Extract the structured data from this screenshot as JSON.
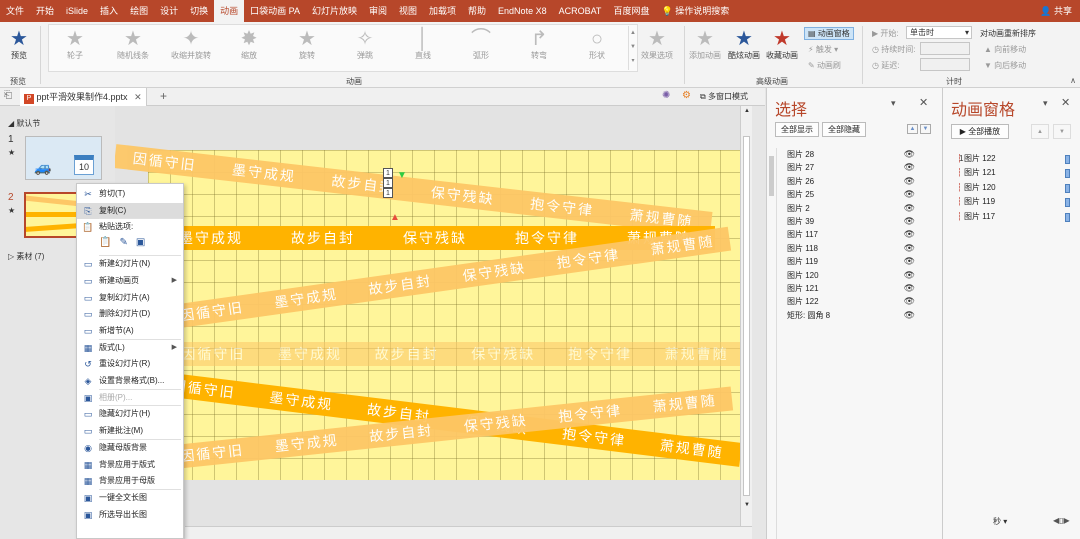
{
  "menubar": {
    "items": [
      "文件",
      "开始",
      "iSlide",
      "插入",
      "绘图",
      "设计",
      "切换",
      "动画",
      "口袋动画 PA",
      "幻灯片放映",
      "审阅",
      "视图",
      "加载项",
      "帮助",
      "EndNote X8",
      "ACROBAT",
      "百度网盘"
    ],
    "active_index": 7,
    "search_label": "操作说明搜索",
    "share_label": "共享"
  },
  "ribbon": {
    "preview_label": "预览",
    "preview_group": "预览",
    "effects": [
      "轮子",
      "随机线条",
      "收缩并旋转",
      "缩放",
      "旋转",
      "弹跳",
      "直线",
      "弧形",
      "转弯",
      "形状"
    ],
    "effect_options_label": "效果选项",
    "animation_group": "动画",
    "add_animation_label": "添加动画",
    "cool_animation_label": "酷炫动画",
    "collect_animation_label": "收藏动画",
    "animation_pane_label": "动画窗格",
    "trigger_label": "触发",
    "painter_label": "动画刷",
    "advanced_group": "高级动画",
    "start_label": "开始:",
    "start_value": "单击时",
    "duration_label": "持续时间:",
    "delay_label": "延迟:",
    "timing_group": "计时",
    "reorder_label": "对动画重新排序",
    "move_earlier": "向前移动",
    "move_later": "向后移动"
  },
  "tabbar": {
    "file_name": "ppt平滑效果制作4.pptx",
    "multi_window": "多窗口模式"
  },
  "thumbs": {
    "section_label": "默认节",
    "slide1_num": "1",
    "slide2_num": "2",
    "star": "★",
    "calendar_num": "10",
    "section2_label": "素材 (7)"
  },
  "slide": {
    "phrases": [
      "因循守旧",
      "墨守成规",
      "故步自封",
      "保守残缺",
      "抱令守律",
      "萧规曹随"
    ],
    "anim_tags": [
      "1",
      "1",
      "1"
    ]
  },
  "context_menu": {
    "items": [
      {
        "label": "剪切(T)",
        "icon": "✂",
        "name": "cut"
      },
      {
        "label": "复制(C)",
        "icon": "⎘",
        "name": "copy",
        "highlight": true
      },
      {
        "label": "粘贴选项:",
        "icon": "📋",
        "name": "paste-options"
      },
      {
        "label": "新建幻灯片(N)",
        "icon": "▭",
        "name": "new-slide"
      },
      {
        "label": "新建动画页",
        "icon": "▭",
        "name": "new-animation-page",
        "submenu": true
      },
      {
        "label": "复制幻灯片(A)",
        "icon": "▭",
        "name": "duplicate-slide"
      },
      {
        "label": "删除幻灯片(D)",
        "icon": "▭",
        "name": "delete-slide"
      },
      {
        "label": "新增节(A)",
        "icon": "▭",
        "name": "add-section"
      },
      {
        "label": "版式(L)",
        "icon": "▦",
        "name": "layout",
        "submenu": true
      },
      {
        "label": "重设幻灯片(R)",
        "icon": "↺",
        "name": "reset-slide"
      },
      {
        "label": "设置背景格式(B)...",
        "icon": "◈",
        "name": "format-background"
      },
      {
        "label": "相册(P)...",
        "icon": "▣",
        "name": "photo-album",
        "disabled": true
      },
      {
        "label": "隐藏幻灯片(H)",
        "icon": "▭",
        "name": "hide-slide"
      },
      {
        "label": "新建批注(M)",
        "icon": "▭",
        "name": "new-comment"
      },
      {
        "label": "隐藏母版背景",
        "icon": "◉",
        "name": "hide-master-bg"
      },
      {
        "label": "背景应用于版式",
        "icon": "▦",
        "name": "bg-apply-layout"
      },
      {
        "label": "背景应用于母版",
        "icon": "▦",
        "name": "bg-apply-master"
      },
      {
        "label": "一键全文长图",
        "icon": "▣",
        "name": "full-long-image"
      },
      {
        "label": "所选导出长图",
        "icon": "▣",
        "name": "export-long-image"
      }
    ]
  },
  "selection_pane": {
    "title": "选择",
    "show_all": "全部显示",
    "hide_all": "全部隐藏",
    "items": [
      "图片 28",
      "图片 27",
      "图片 26",
      "图片 25",
      "图片 2",
      "图片 39",
      "图片 117",
      "图片 118",
      "图片 119",
      "图片 120",
      "图片 121",
      "图片 122",
      "矩形: 圆角 8"
    ]
  },
  "animation_pane": {
    "title": "动画窗格",
    "play_all": "全部播放",
    "first_index": "1",
    "items": [
      "图片 122",
      "图片 121",
      "图片 120",
      "图片 119",
      "图片 117"
    ],
    "seconds_label": "秒"
  },
  "colors": {
    "accent": "#b7472a",
    "slide_bg": "#fff59a",
    "band_light": "#fdc766",
    "band_dark": "#ffb300"
  }
}
